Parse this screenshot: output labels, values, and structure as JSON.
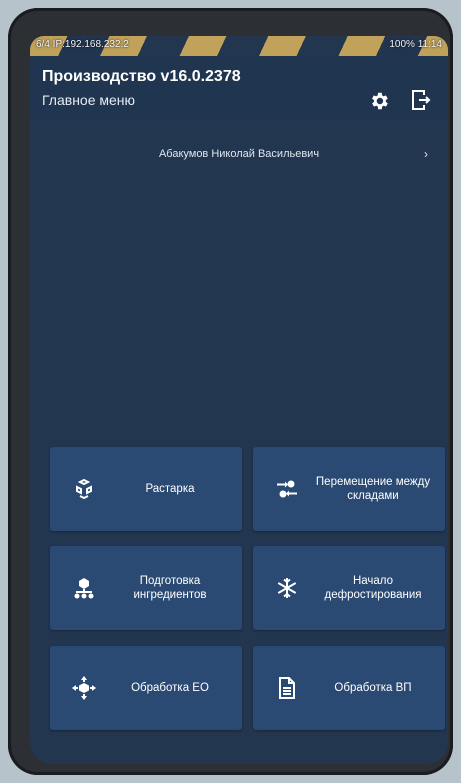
{
  "colors": {
    "screen_bg": "#233650",
    "header_bg": "#1f3550",
    "tile_bg": "#2a4a73",
    "text": "#ffffff",
    "status_stripe": "#c9a85b"
  },
  "statusbar": {
    "left_text": "6/4 IP:192.168.232.2",
    "right_text": "100% 11:14"
  },
  "header": {
    "title": "Производство v16.0.2378",
    "subtitle": "Главное меню",
    "settings_icon": "gear-icon",
    "logout_icon": "logout-icon"
  },
  "user": {
    "name": "Абакумов Николай Васильевич",
    "chevron": "›"
  },
  "tiles": [
    {
      "label": "Растарка",
      "icon": "unpack-icon"
    },
    {
      "label": "Перемещение между складами",
      "icon": "transfer-icon"
    },
    {
      "label": "Подготовка ингредиентов",
      "icon": "ingredients-icon"
    },
    {
      "label": "Начало дефростирования",
      "icon": "snowflake-icon"
    },
    {
      "label": "Обработка ЕО",
      "icon": "box-arrows-icon"
    },
    {
      "label": "Обработка ВП",
      "icon": "document-icon"
    }
  ]
}
